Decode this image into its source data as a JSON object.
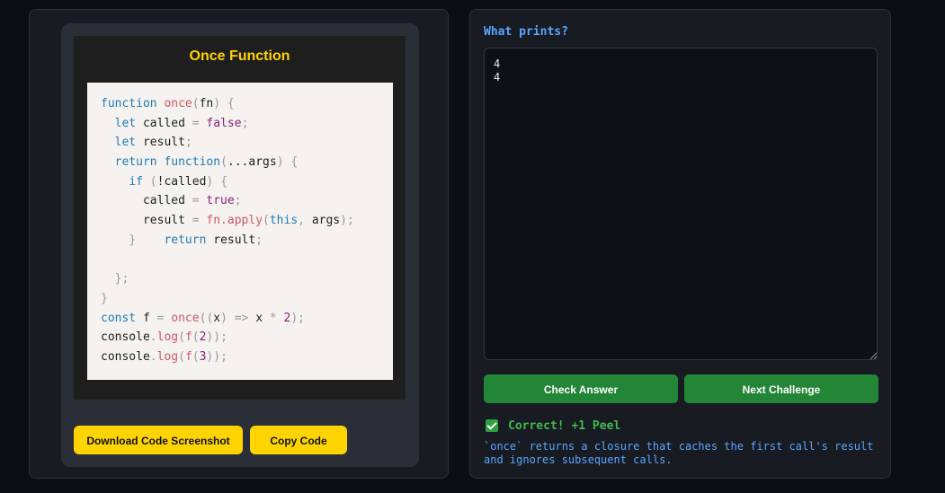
{
  "challenge": {
    "title": "Once Function",
    "code_lines": [
      [
        {
          "t": "function",
          "c": "kw"
        },
        {
          "t": " ",
          "c": "txt"
        },
        {
          "t": "once",
          "c": "fn"
        },
        {
          "t": "(",
          "c": "pun"
        },
        {
          "t": "fn",
          "c": "txt"
        },
        {
          "t": ")",
          "c": "pun"
        },
        {
          "t": " {",
          "c": "pun"
        }
      ],
      [
        {
          "t": "  ",
          "c": "txt"
        },
        {
          "t": "let",
          "c": "kw"
        },
        {
          "t": " called ",
          "c": "txt"
        },
        {
          "t": "=",
          "c": "pun"
        },
        {
          "t": " ",
          "c": "txt"
        },
        {
          "t": "false",
          "c": "val"
        },
        {
          "t": ";",
          "c": "pun"
        }
      ],
      [
        {
          "t": "  ",
          "c": "txt"
        },
        {
          "t": "let",
          "c": "kw"
        },
        {
          "t": " result",
          "c": "txt"
        },
        {
          "t": ";",
          "c": "pun"
        }
      ],
      [
        {
          "t": "  ",
          "c": "txt"
        },
        {
          "t": "return",
          "c": "kw"
        },
        {
          "t": " ",
          "c": "txt"
        },
        {
          "t": "function",
          "c": "kw"
        },
        {
          "t": "(",
          "c": "pun"
        },
        {
          "t": "...",
          "c": "txt"
        },
        {
          "t": "args",
          "c": "txt"
        },
        {
          "t": ")",
          "c": "pun"
        },
        {
          "t": " {",
          "c": "pun"
        }
      ],
      [
        {
          "t": "    ",
          "c": "txt"
        },
        {
          "t": "if",
          "c": "kw"
        },
        {
          "t": " (",
          "c": "pun"
        },
        {
          "t": "!",
          "c": "txt"
        },
        {
          "t": "called",
          "c": "txt"
        },
        {
          "t": ")",
          "c": "pun"
        },
        {
          "t": " {",
          "c": "pun"
        }
      ],
      [
        {
          "t": "      called ",
          "c": "txt"
        },
        {
          "t": "=",
          "c": "pun"
        },
        {
          "t": " ",
          "c": "txt"
        },
        {
          "t": "true",
          "c": "val"
        },
        {
          "t": ";",
          "c": "pun"
        }
      ],
      [
        {
          "t": "      result ",
          "c": "txt"
        },
        {
          "t": "=",
          "c": "pun"
        },
        {
          "t": " ",
          "c": "txt"
        },
        {
          "t": "fn.apply",
          "c": "fn"
        },
        {
          "t": "(",
          "c": "pun"
        },
        {
          "t": "this",
          "c": "kw"
        },
        {
          "t": ",",
          "c": "pun"
        },
        {
          "t": " args",
          "c": "txt"
        },
        {
          "t": ");",
          "c": "pun"
        }
      ],
      [
        {
          "t": "    }",
          "c": "pun"
        },
        {
          "t": "    ",
          "c": "txt"
        },
        {
          "t": "return",
          "c": "kw"
        },
        {
          "t": " result",
          "c": "txt"
        },
        {
          "t": ";",
          "c": "pun"
        }
      ],
      [
        {
          "t": " ",
          "c": "txt"
        }
      ],
      [
        {
          "t": "  };",
          "c": "pun"
        }
      ],
      [
        {
          "t": "}",
          "c": "pun"
        }
      ],
      [
        {
          "t": "const",
          "c": "kw"
        },
        {
          "t": " f ",
          "c": "txt"
        },
        {
          "t": "=",
          "c": "pun"
        },
        {
          "t": " ",
          "c": "txt"
        },
        {
          "t": "once",
          "c": "fn"
        },
        {
          "t": "((",
          "c": "pun"
        },
        {
          "t": "x",
          "c": "txt"
        },
        {
          "t": ")",
          "c": "pun"
        },
        {
          "t": " ",
          "c": "txt"
        },
        {
          "t": "=>",
          "c": "pun"
        },
        {
          "t": " x ",
          "c": "txt"
        },
        {
          "t": "*",
          "c": "pun"
        },
        {
          "t": " ",
          "c": "txt"
        },
        {
          "t": "2",
          "c": "val"
        },
        {
          "t": ");",
          "c": "pun"
        }
      ],
      [
        {
          "t": "console",
          "c": "txt"
        },
        {
          "t": ".",
          "c": "pun"
        },
        {
          "t": "log",
          "c": "fn"
        },
        {
          "t": "(",
          "c": "pun"
        },
        {
          "t": "f",
          "c": "fn"
        },
        {
          "t": "(",
          "c": "pun"
        },
        {
          "t": "2",
          "c": "val"
        },
        {
          "t": "));",
          "c": "pun"
        }
      ],
      [
        {
          "t": "console",
          "c": "txt"
        },
        {
          "t": ".",
          "c": "pun"
        },
        {
          "t": "log",
          "c": "fn"
        },
        {
          "t": "(",
          "c": "pun"
        },
        {
          "t": "f",
          "c": "fn"
        },
        {
          "t": "(",
          "c": "pun"
        },
        {
          "t": "3",
          "c": "val"
        },
        {
          "t": "));",
          "c": "pun"
        }
      ]
    ],
    "download_label": "Download Code Screenshot",
    "copy_label": "Copy Code"
  },
  "quiz": {
    "question": "What prints?",
    "answer_value": "4\n4",
    "check_label": "Check Answer",
    "next_label": "Next Challenge",
    "feedback_icon": "check-icon",
    "feedback": "Correct! +1 Peel",
    "explanation": "`once` returns a closure that caches the first call's result and ignores subsequent calls."
  },
  "colors": {
    "accent_yellow": "#ffd400",
    "accent_green": "#238636",
    "link_blue": "#58a6ff",
    "success_green": "#3fb950"
  }
}
